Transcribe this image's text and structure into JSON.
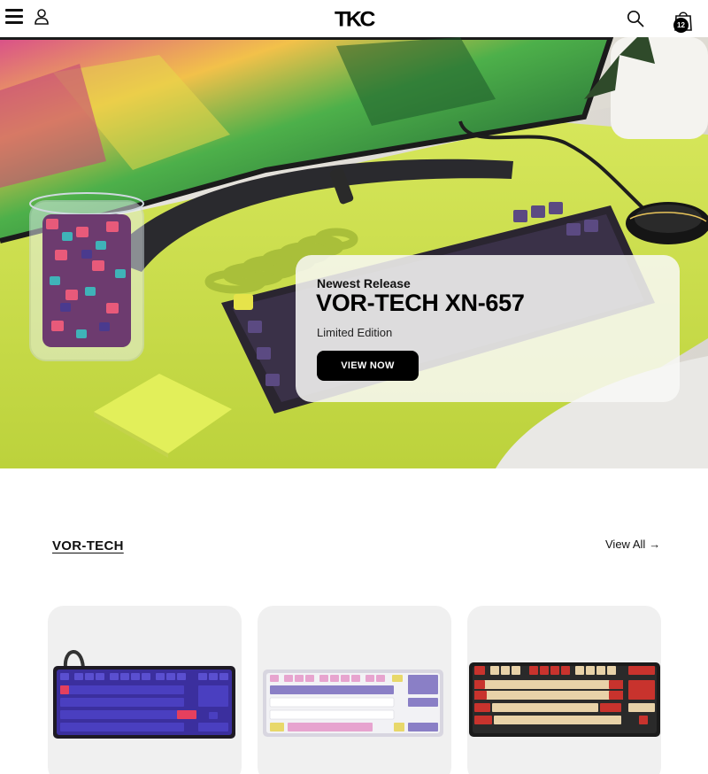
{
  "header": {
    "logo": "TKC",
    "cart_count": "12",
    "icons": [
      "menu-icon",
      "user-icon",
      "search-icon",
      "cart-icon"
    ]
  },
  "hero": {
    "eyebrow": "Newest Release",
    "title": "VOR-TECH XN-657",
    "subtitle": "Limited Edition",
    "button_label": "VIEW NOW"
  },
  "section": {
    "title": "VOR-TECH",
    "view_all_label": "View All",
    "view_all_arrow": "→"
  },
  "products": [
    {
      "name": "purple-tkl-keyboard"
    },
    {
      "name": "pastel-tkl-keyboard"
    },
    {
      "name": "red-beige-keyboard"
    }
  ],
  "colors": {
    "accent_black": "#000000",
    "desk_mat_lime": "#c9dc4a",
    "card_background": "#f0f0f0"
  }
}
